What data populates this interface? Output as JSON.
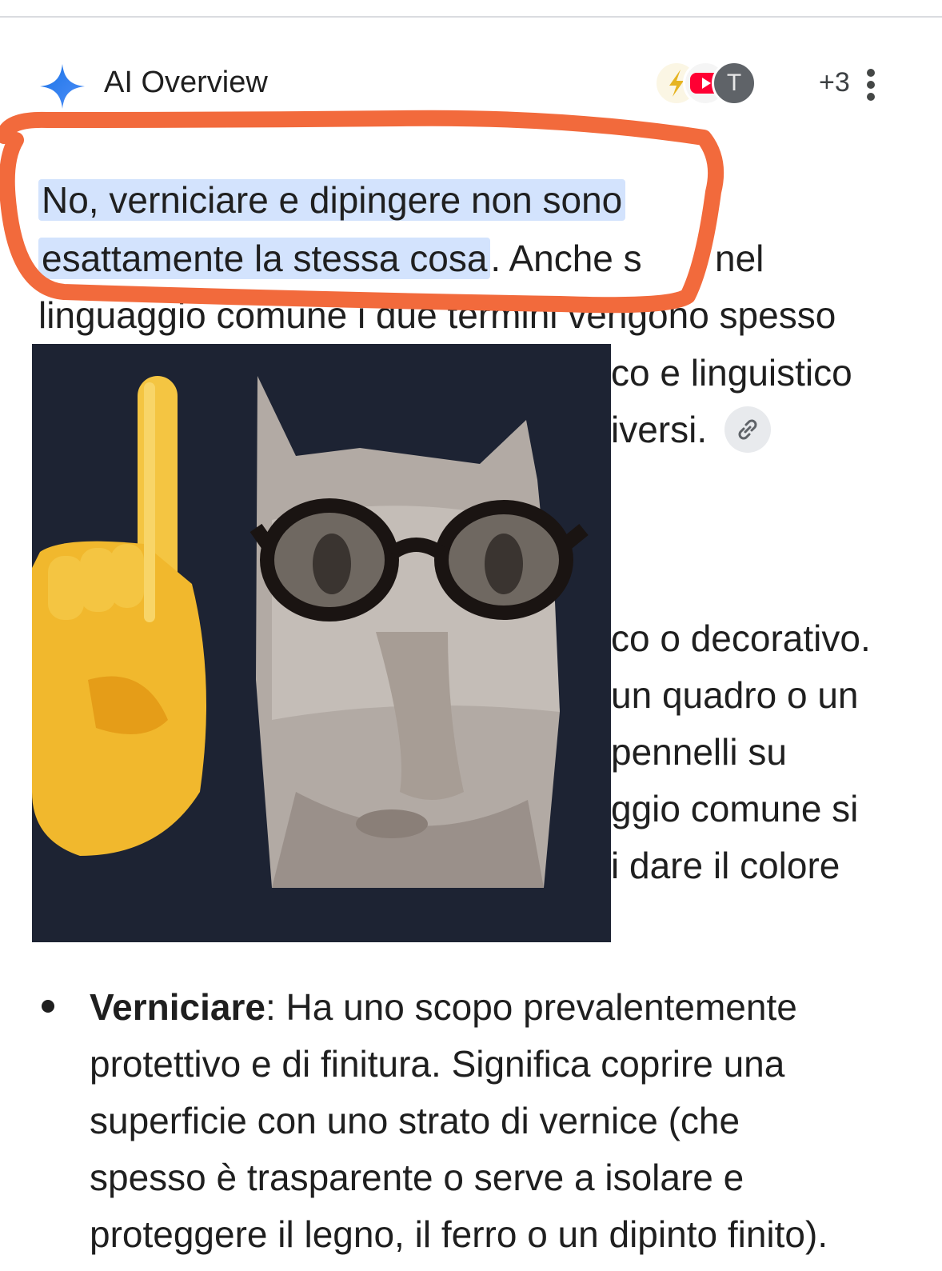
{
  "header": {
    "title": "AI Overview",
    "source_count": "+3",
    "avatar_letter": "T"
  },
  "answer": {
    "highlight_line1": "No, verniciare e dipingere non sono",
    "highlight_line2": "esattamente la stessa cosa",
    "line2_tail": ". Anche s",
    "line2_after": "nel",
    "line3": "linguaggio comune i due termini vengono spesso",
    "frag_1": "co e linguistico",
    "frag_2": "iversi.",
    "frag_3": "co o decorativo.",
    "frag_4": "un quadro o un",
    "frag_5": "pennelli su",
    "frag_6": "ggio comune si",
    "frag_7": "i dare il colore"
  },
  "bullet": {
    "term": "Verniciare",
    "lines": [
      ": Ha uno scopo prevalentemente",
      "protettivo e di finitura. Significa coprire una",
      "superficie con uno strato di vernice (che",
      "spesso è trasparente o serve a isolare e",
      "proteggere il legno, il ferro o un dipinto finito)."
    ]
  },
  "colors": {
    "highlight": "#d3e3fd",
    "gemini_blue": "#4285f4",
    "scribble": "#f26a3c"
  }
}
